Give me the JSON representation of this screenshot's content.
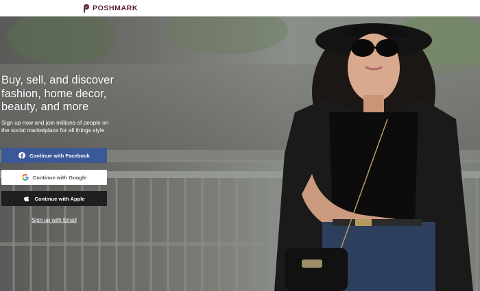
{
  "header": {
    "logo_text": "POSHMARK",
    "logo_icon": "poshmark-p-icon"
  },
  "hero": {
    "headline": "Buy, sell, and discover fashion, home decor, beauty, and more",
    "subtext": "Sign up now and join millions of people on the social marketplace for all things style",
    "buttons": {
      "facebook": {
        "label": "Continue with Facebook",
        "icon": "facebook-icon"
      },
      "google": {
        "label": "Continue with Google",
        "icon": "google-icon"
      },
      "apple": {
        "label": "Continue with Apple",
        "icon": "apple-icon"
      }
    },
    "email_link": "Sign up with Email"
  },
  "colors": {
    "brand": "#5b1a3a",
    "facebook": "#3b5998",
    "apple": "#1f1f1f",
    "text_light": "#ffffff"
  }
}
